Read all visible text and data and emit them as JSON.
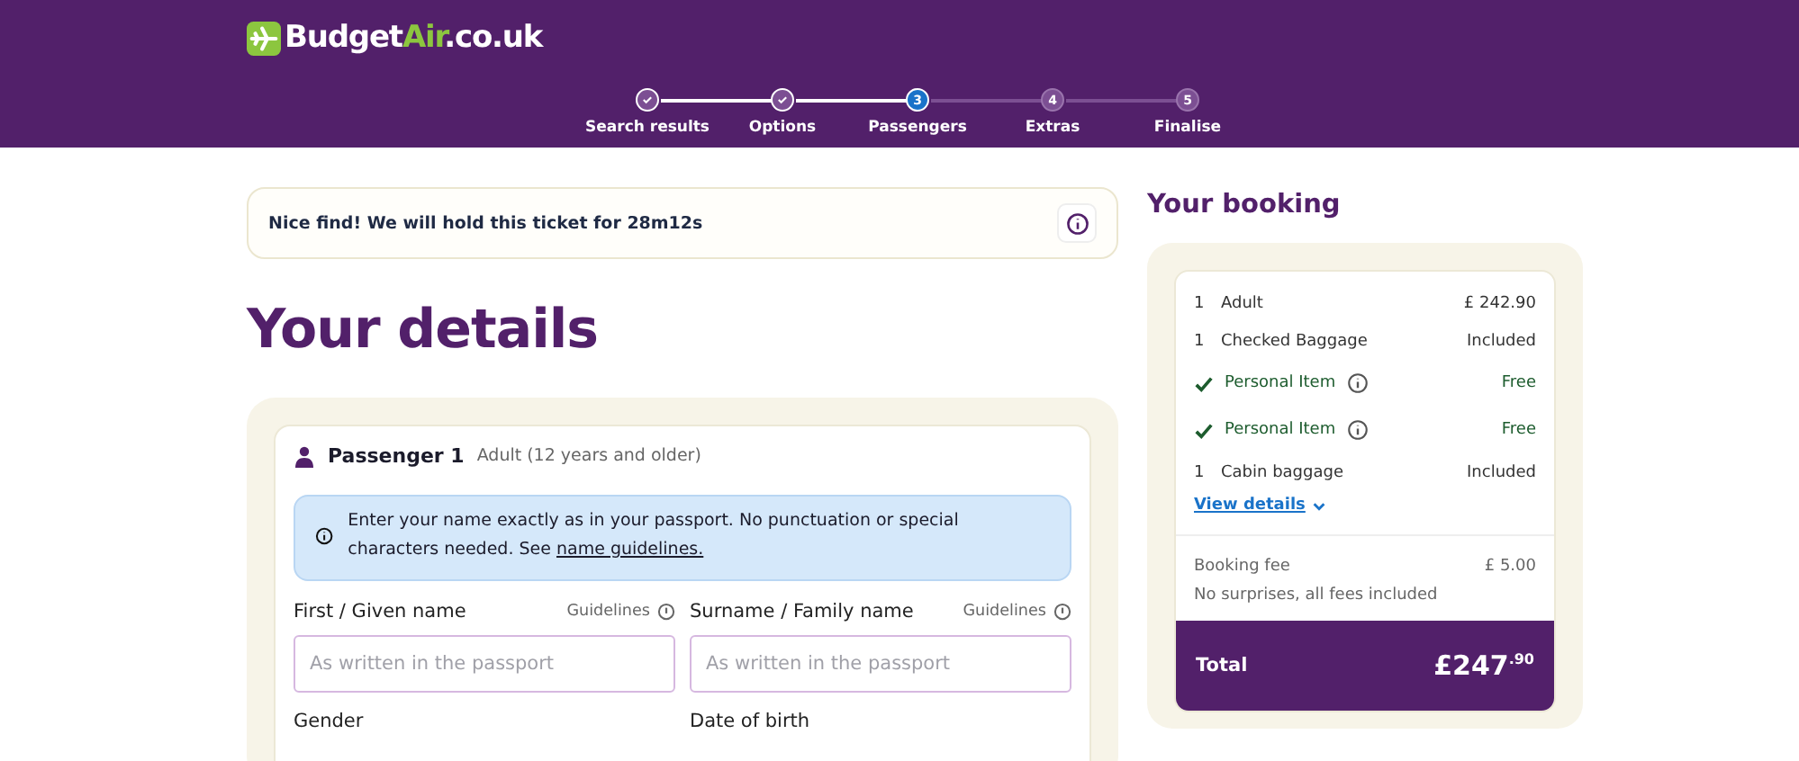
{
  "header": {
    "logo": {
      "start": "Budget",
      "accent": "Air",
      "end": ".co.uk"
    },
    "steps": [
      {
        "label": "Search results",
        "completed": true,
        "selected": false
      },
      {
        "label": "Options",
        "completed": true,
        "selected": false
      },
      {
        "label": "Passengers",
        "number": "3",
        "completed": false,
        "selected": true
      },
      {
        "label": "Extras",
        "number": "4",
        "completed": false,
        "selected": false
      },
      {
        "label": "Finalise",
        "number": "5",
        "completed": false,
        "selected": false
      }
    ]
  },
  "notice": {
    "text": "Nice find! We will hold this ticket for 28m12s"
  },
  "title": "Your details",
  "passenger": {
    "name": "Passenger 1",
    "type": "Adult (12 years and older)",
    "info": {
      "text": "Enter your name exactly as in your passport. No punctuation or special characters needed. See ",
      "link": "name guidelines."
    },
    "fields": [
      {
        "label": "First / Given name",
        "hint": "Guidelines",
        "placeholder": "As written in the passport"
      },
      {
        "label": "Surname / Family name",
        "hint": "Guidelines",
        "placeholder": "As written in the passport"
      }
    ],
    "next_labels": [
      "Gender",
      "Date of birth"
    ]
  },
  "booking": {
    "title": "Your booking",
    "lines": [
      {
        "kind": "count",
        "qty": "1",
        "label": "Adult",
        "value": "£ 242.90"
      },
      {
        "kind": "count",
        "qty": "1",
        "label": "Checked Baggage",
        "value": "Included"
      },
      {
        "kind": "free",
        "label": "Personal Item",
        "value": "Free"
      },
      {
        "kind": "free",
        "label": "Personal Item",
        "value": "Free"
      },
      {
        "kind": "count",
        "qty": "1",
        "label": "Cabin baggage",
        "value": "Included"
      }
    ],
    "view_details": "View details",
    "fee": {
      "label": "Booking fee",
      "value": "£ 5.00"
    },
    "note": "No surprises, all fees included",
    "total": {
      "label": "Total",
      "value": "£247$^{.90}$"
    }
  }
}
